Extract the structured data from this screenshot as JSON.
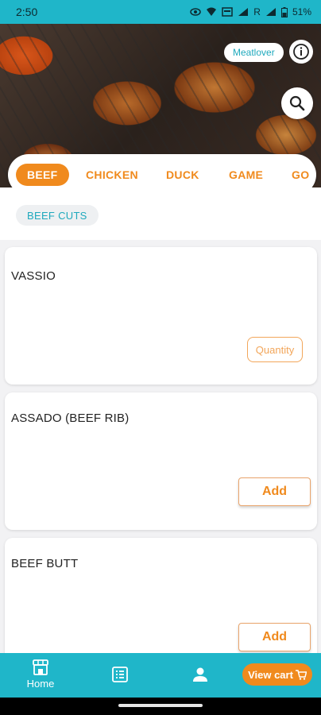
{
  "status_bar": {
    "time": "2:50",
    "battery": "51%",
    "signal_label": "R",
    "icons": [
      "eye-icon",
      "wifi-icon",
      "nfc-icon",
      "signal-icon",
      "battery-icon"
    ]
  },
  "hero": {
    "image": "grilled-chicken-wings-photo",
    "brand_pill": "Meatlover",
    "icons": [
      "info-icon",
      "search-icon"
    ]
  },
  "categories": {
    "items": [
      "BEEF",
      "CHICKEN",
      "DUCK",
      "GAME",
      "GO"
    ],
    "selected": "BEEF"
  },
  "subcategory": {
    "label": "BEEF CUTS"
  },
  "products": [
    {
      "name": "VASSIO",
      "action": "Quantity"
    },
    {
      "name": "ASSADO (BEEF RIB)",
      "action": "Add"
    },
    {
      "name": "BEEF BUTT",
      "action": "Add"
    }
  ],
  "bottom_nav": {
    "home_label": "Home",
    "view_cart_label": "View cart",
    "icons": [
      "store-icon",
      "orders-icon",
      "profile-icon",
      "cart-icon"
    ]
  },
  "colors": {
    "primary": "#1fb6c9",
    "accent": "#f08a1d",
    "background": "#f2f2f4"
  }
}
